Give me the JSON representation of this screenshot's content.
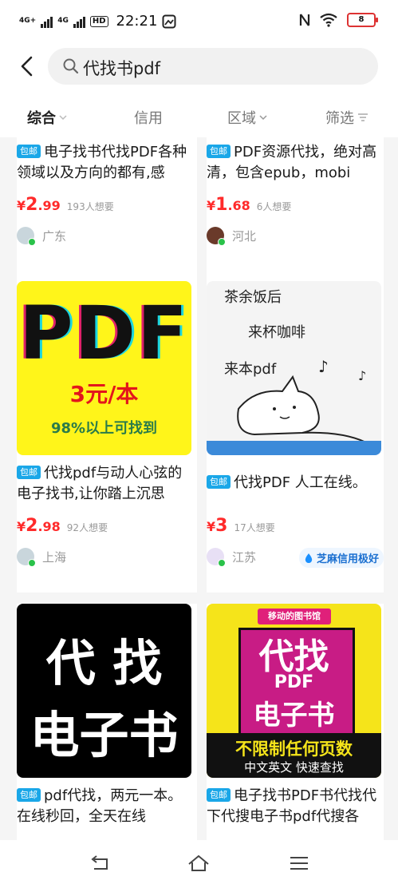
{
  "status_bar": {
    "net1": "4G+",
    "net2": "4G",
    "hd": "HD",
    "time": "22:21",
    "battery": "8"
  },
  "search": {
    "query": "代找书pdf"
  },
  "filters": {
    "comprehensive": "综合",
    "credit": "信用",
    "region": "区域",
    "filter": "筛选"
  },
  "products": [
    {
      "badge": "包邮",
      "title": "电子找书代找PDF各种领域以及方向的都有,感",
      "price_yen": "¥",
      "price_int": "2",
      "price_dec": ".99",
      "want": "193人想要",
      "location": "广东"
    },
    {
      "badge": "包邮",
      "title": "PDF资源代找，绝对高清，包含epub，mobi",
      "price_yen": "¥",
      "price_int": "1",
      "price_dec": ".68",
      "want": "6人想要",
      "location": "河北"
    },
    {
      "badge": "包邮",
      "title": "代找pdf与动人心弦的电子找书,让你踏上沉思",
      "price_yen": "¥",
      "price_int": "2",
      "price_dec": ".98",
      "want": "92人想要",
      "location": "上海",
      "image": {
        "big": "PDF",
        "price": "3元/本",
        "sub": "98%以上可找到"
      }
    },
    {
      "badge": "包邮",
      "title": "代找PDF 人工在线。",
      "price_yen": "¥",
      "price_int": "3",
      "price_dec": "",
      "want": "17人想要",
      "location": "江苏",
      "credit_badge": "芝麻信用极好",
      "image": {
        "l1": "茶余饭后",
        "l2": "来杯咖啡",
        "l3": "来本pdf"
      }
    },
    {
      "badge": "包邮",
      "title": "pdf代找，两元一本。在线秒回，全天在线",
      "image": {
        "l1": "代  找",
        "l2": "电子书"
      }
    },
    {
      "badge": "包邮",
      "title": "电子找书PDF书代找代下代搜电子书pdf代搜各",
      "image": {
        "banner": "移动的图书馆",
        "l1": "代找",
        "l2": "PDF",
        "l3": "电子书",
        "l4": "不限制任何页数",
        "l5": "中文英文  快速查找"
      }
    }
  ]
}
